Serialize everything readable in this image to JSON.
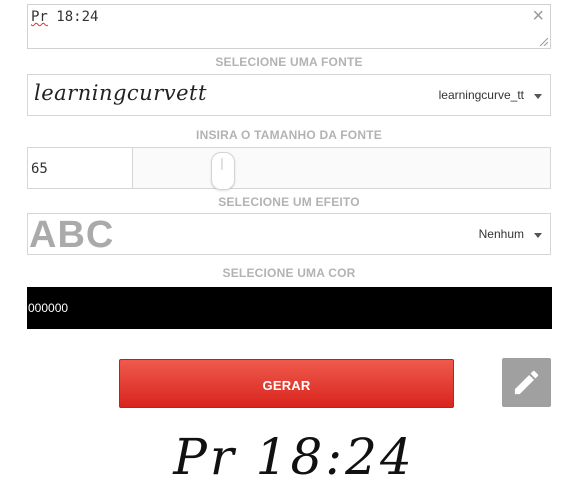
{
  "text_input": {
    "value_part1": "Pr",
    "value_part2": " 18:24",
    "clear_glyph": "×"
  },
  "font_section": {
    "label": "SELECIONE UMA FONTE",
    "preview": "learningcurvett",
    "selected": "learningcurve_tt"
  },
  "size_section": {
    "label": "INSIRA O TAMANHO DA FONTE",
    "value": "65"
  },
  "effect_section": {
    "label": "SELECIONE UM EFEITO",
    "preview": "ABC",
    "selected": "Nenhum"
  },
  "color_section": {
    "label": "SELECIONE UMA COR",
    "value": "000000",
    "color": "#000000"
  },
  "generate_button": {
    "label": "GERAR",
    "color": "#e0352b"
  },
  "edit_button": {
    "icon": "pencil-icon",
    "color": "#a0a0a0"
  },
  "output": {
    "text": "Pr 18:24"
  }
}
